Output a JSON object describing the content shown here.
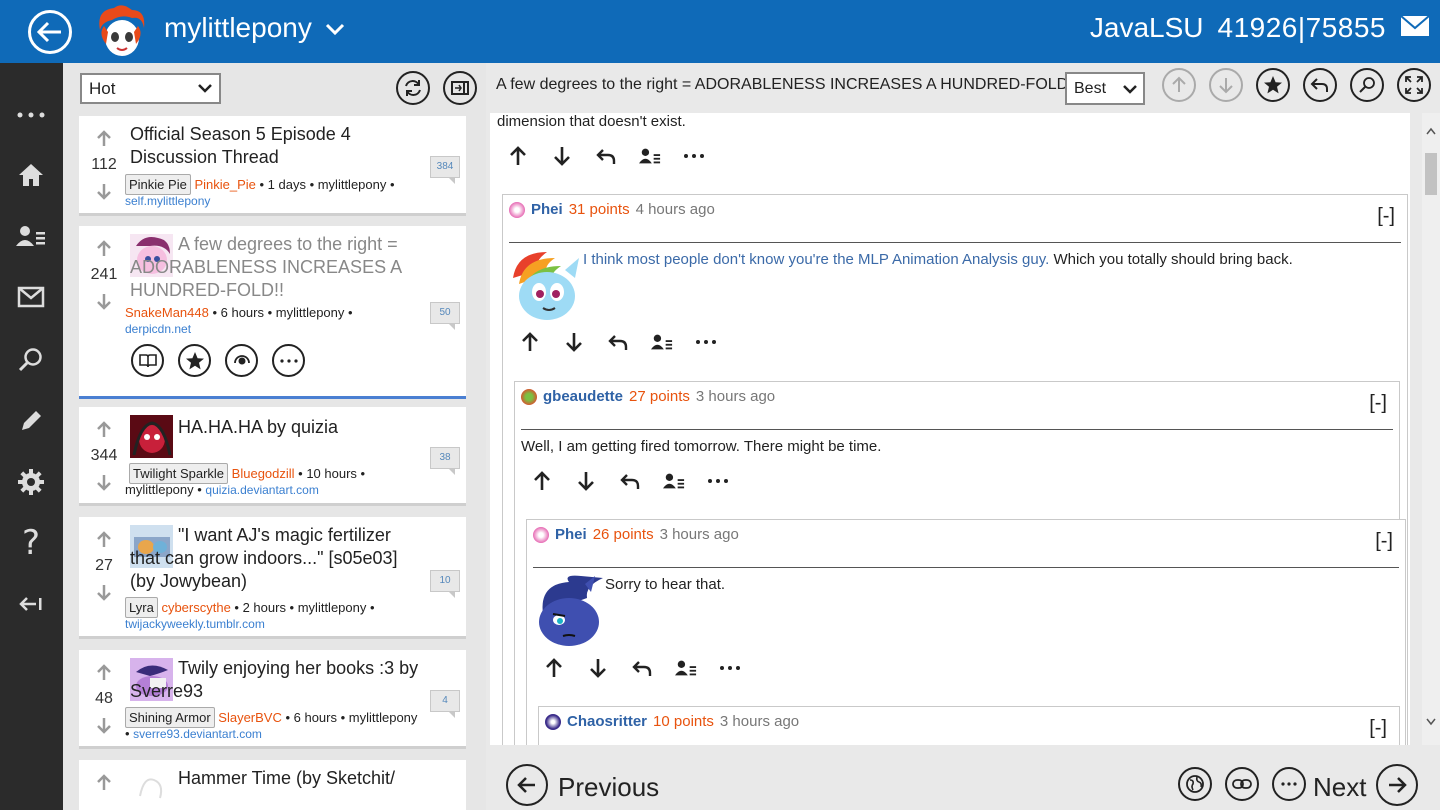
{
  "header": {
    "subreddit": "mylittlepony",
    "username": "JavaLSU",
    "karma": "41926|75855"
  },
  "list": {
    "sort_value": "Hot",
    "posts": [
      {
        "score": "112",
        "title": "Official Season 5 Episode 4 Discussion Thread",
        "flair": "Pinkie Pie",
        "author": "Pinkie_Pie",
        "meta": " • 1 days • mylittlepony •",
        "domain": "self.mylittlepony",
        "comments": "384"
      },
      {
        "score": "241",
        "title": "A few degrees to the right = ADORABLENESS INCREASES A HUNDRED-FOLD!!",
        "author": "SnakeMan448",
        "meta": " • 6 hours • mylittlepony •",
        "domain": "derpicdn.net",
        "comments": "50"
      },
      {
        "score": "344",
        "title": "HA.HA.HA by quizia",
        "flair": "Twilight Sparkle",
        "author": "Bluegodzill",
        "meta": " • 10 hours •",
        "meta2": "mylittlepony • ",
        "domain": "quizia.deviantart.com",
        "comments": "38"
      },
      {
        "score": "27",
        "title": "\"I want AJ's magic fertilizer that can grow indoors...\" [s05e03] (by Jowybean)",
        "flair": "Lyra",
        "author": "cyberscythe",
        "meta": " • 2 hours • mylittlepony •",
        "domain": "twijackyweekly.tumblr.com",
        "comments": "10"
      },
      {
        "score": "48",
        "title": "Twily enjoying her books :3 by Sverre93",
        "flair": "Shining Armor",
        "author": "SlayerBVC",
        "meta": " • 6 hours • mylittlepony",
        "meta2": "• ",
        "domain": "sverre93.deviantart.com",
        "comments": "4"
      },
      {
        "title": "Hammer Time (by Sketchit/"
      }
    ]
  },
  "thread": {
    "post_title": "A few degrees to the right = ADORABLENESS INCREASES A HUNDRED-FOLD!!",
    "sort_value": "Best",
    "partial_text": "dimension that doesn't exist.",
    "comments": [
      {
        "user": "Phei",
        "points": "31 points",
        "age": "4 hours ago",
        "link_text": "I think most people don't know you're the MLP Animation Analysis guy.",
        "text": " Which you totally should bring back.",
        "collapse": "[-]"
      },
      {
        "user": "gbeaudette",
        "points": "27 points",
        "age": "3 hours ago",
        "text": "Well, I am getting fired tomorrow. There might be time.",
        "collapse": "[-]"
      },
      {
        "user": "Phei",
        "points": "26 points",
        "age": "3 hours ago",
        "text": "Sorry to hear that.",
        "collapse": "[-]"
      },
      {
        "user": "Chaosritter",
        "points": "10 points",
        "age": "3 hours ago",
        "collapse": "[-]"
      }
    ]
  },
  "bottom_nav": {
    "previous": "Previous",
    "next": "Next"
  },
  "colors": {
    "header": "#0f6ab8",
    "nav": "#2b2b2b",
    "author": "#e8530e",
    "link": "#2f62a6"
  }
}
